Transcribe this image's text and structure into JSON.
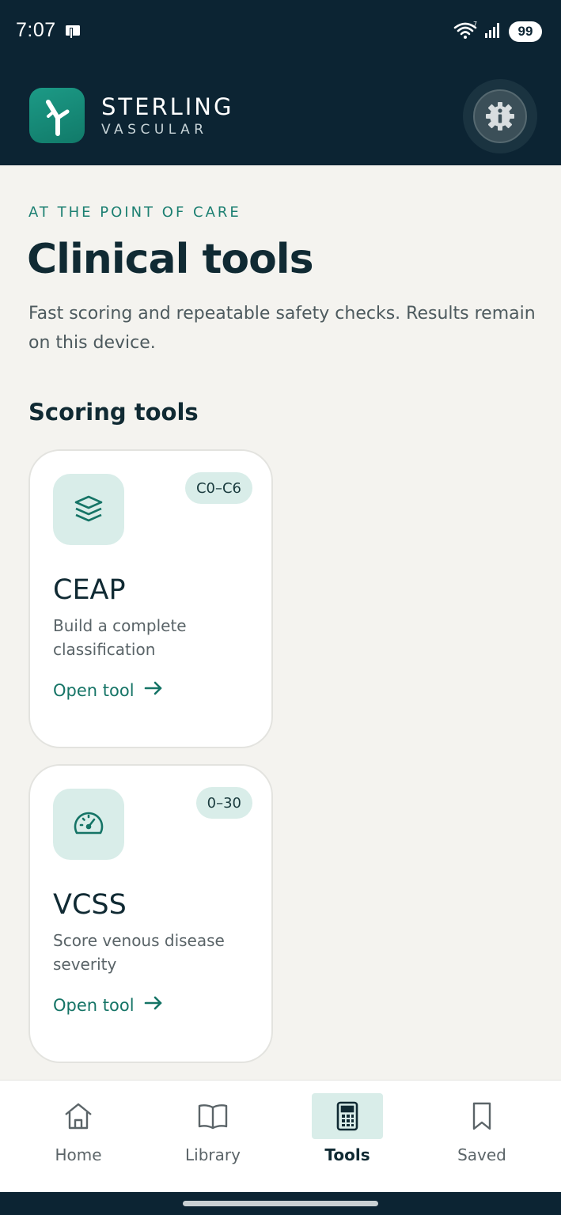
{
  "status_bar": {
    "time": "7:07",
    "battery": "99",
    "icons": [
      "notification-icon",
      "wifi-icon",
      "signal-icon",
      "battery-icon"
    ]
  },
  "header": {
    "brand_name": "STERLING",
    "brand_sub": "VASCULAR",
    "logo_icon": "vessel-branch-icon",
    "settings_icon": "gear-info-icon"
  },
  "page": {
    "eyebrow": "AT THE POINT OF CARE",
    "title": "Clinical tools",
    "description": "Fast scoring and repeatable safety checks. Results remain on this device."
  },
  "section": {
    "title": "Scoring tools"
  },
  "tools": [
    {
      "icon": "layers-icon",
      "badge": "C0–C6",
      "title": "CEAP",
      "description": "Build a complete classification",
      "link": "Open tool"
    },
    {
      "icon": "gauge-icon",
      "badge": "0–30",
      "title": "VCSS",
      "description": "Score venous disease severity",
      "link": "Open tool"
    }
  ],
  "nav": {
    "active": "Tools",
    "items": [
      {
        "label": "Home",
        "icon": "home-icon"
      },
      {
        "label": "Library",
        "icon": "book-icon"
      },
      {
        "label": "Tools",
        "icon": "calculator-icon"
      },
      {
        "label": "Saved",
        "icon": "bookmark-icon"
      }
    ]
  },
  "colors": {
    "header_bg": "#0c2433",
    "accent": "#157466",
    "accent_soft": "#d9ede9",
    "page_bg": "#f4f3ef"
  }
}
